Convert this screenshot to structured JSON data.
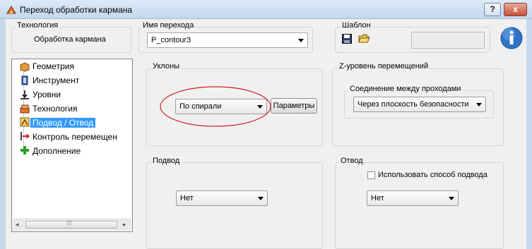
{
  "window": {
    "title": "Переход обработки кармана",
    "help_btn": "?",
    "close_btn": "x"
  },
  "header": {
    "technology_label": "Технология",
    "technology_value": "Обработка кармана",
    "transition_name_label": "Имя перехода",
    "transition_name_value": "P_contour3",
    "template_label": "Шаблон"
  },
  "tree": {
    "items": [
      {
        "label": "Геометрия",
        "icon": "geometry-icon"
      },
      {
        "label": "Инструмент",
        "icon": "tool-icon"
      },
      {
        "label": "Уровни",
        "icon": "levels-icon"
      },
      {
        "label": "Технология",
        "icon": "technology-icon"
      },
      {
        "label": "Подвод / Отвод",
        "icon": "lead-in-out-icon",
        "selected": true
      },
      {
        "label": "Контроль перемещен",
        "icon": "motion-control-icon"
      },
      {
        "label": "Дополнение",
        "icon": "plus-icon"
      }
    ]
  },
  "slopes": {
    "label": "Уклоны",
    "value": "По спирали",
    "params_button": "Параметры"
  },
  "z_level": {
    "label": "Z-уровень перемещений",
    "connection_label": "Соединение между проходами",
    "connection_value": "Через плоскость безопасности"
  },
  "approach": {
    "label": "Подвод",
    "value": "Нет"
  },
  "retract": {
    "label": "Отвод",
    "checkbox_label": "Использовать способ подвода",
    "checkbox_checked": false,
    "value": "Нет"
  },
  "colors": {
    "selection": "#3399ff",
    "annotation_ellipse": "#cc2222",
    "titlebar": "#c4d8ee"
  }
}
